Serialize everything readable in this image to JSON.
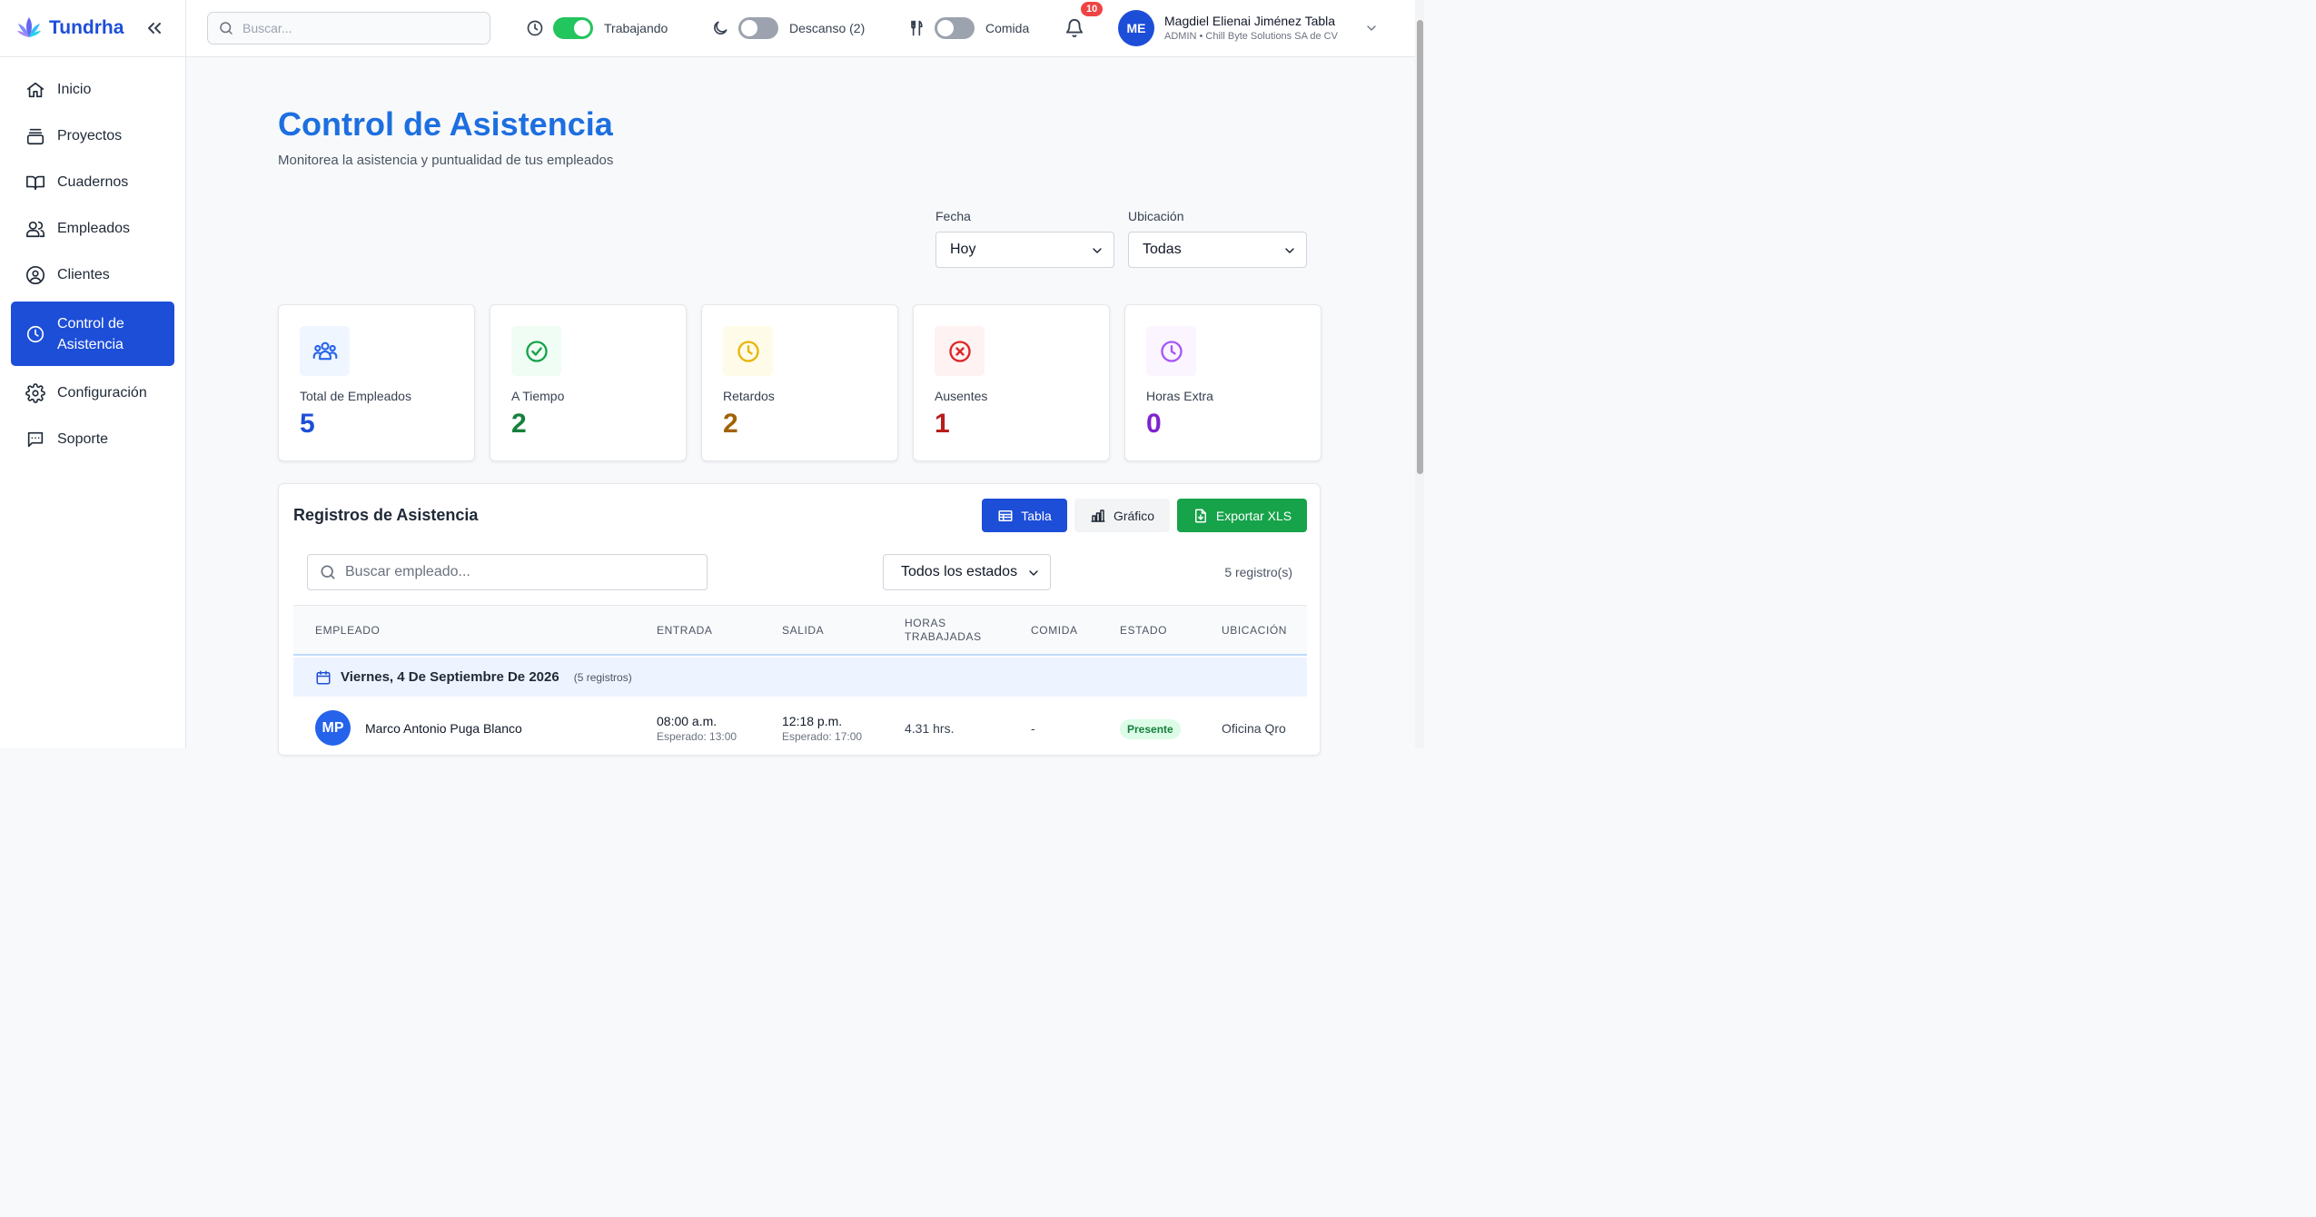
{
  "brand": {
    "name": "Tundrha"
  },
  "sidebar": {
    "items": [
      {
        "label": "Inicio",
        "icon": "home-icon"
      },
      {
        "label": "Proyectos",
        "icon": "folder-icon"
      },
      {
        "label": "Cuadernos",
        "icon": "book-icon"
      },
      {
        "label": "Empleados",
        "icon": "users-icon"
      },
      {
        "label": "Clientes",
        "icon": "user-circle-icon"
      },
      {
        "label": "Control de Asistencia",
        "icon": "clock-icon",
        "active": true
      },
      {
        "label": "Configuración",
        "icon": "gear-icon"
      },
      {
        "label": "Soporte",
        "icon": "chat-icon"
      }
    ]
  },
  "topbar": {
    "search_placeholder": "Buscar...",
    "status_working": {
      "label": "Trabajando",
      "on": true
    },
    "status_break": {
      "label": "Descanso (2)",
      "on": false
    },
    "status_lunch": {
      "label": "Comida",
      "on": false
    },
    "notifications_count": "10",
    "user": {
      "initials": "ME",
      "name": "Magdiel Elienai Jiménez Tabla",
      "role": "ADMIN • Chill Byte Solutions SA de CV"
    }
  },
  "page": {
    "title": "Control de Asistencia",
    "subtitle": "Monitorea la asistencia y puntualidad de tus empleados"
  },
  "filters": {
    "date_label": "Fecha",
    "date_value": "Hoy",
    "location_label": "Ubicación",
    "location_value": "Todas"
  },
  "stats": [
    {
      "label": "Total de Empleados",
      "value": "5",
      "color": "#1d4ed8",
      "bg": "#eff6ff",
      "icon": "users-icon"
    },
    {
      "label": "A Tiempo",
      "value": "2",
      "color": "#15803d",
      "bg": "#f0fdf4",
      "icon": "check-circle-icon"
    },
    {
      "label": "Retardos",
      "value": "2",
      "color": "#a16207",
      "bg": "#fefce8",
      "icon": "clock-icon"
    },
    {
      "label": "Ausentes",
      "value": "1",
      "color": "#b91c1c",
      "bg": "#fef2f2",
      "icon": "x-circle-icon"
    },
    {
      "label": "Horas Extra",
      "value": "0",
      "color": "#7e22ce",
      "bg": "#faf5ff",
      "icon": "clock-icon"
    }
  ],
  "records": {
    "title": "Registros de Asistencia",
    "view_table_label": "Tabla",
    "view_chart_label": "Gráfico",
    "export_label": "Exportar XLS",
    "search_placeholder": "Buscar empleado...",
    "status_filter": "Todos los estados",
    "count_text": "5 registro(s)",
    "columns": {
      "employee": "EMPLEADO",
      "entry": "ENTRADA",
      "exit": "SALIDA",
      "hours_1": "HORAS",
      "hours_2": "TRABAJADAS",
      "lunch": "COMIDA",
      "status": "ESTADO",
      "location": "UBICACIÓN"
    },
    "group": {
      "date": "Viernes, 4 De Septiembre De 2026",
      "count": "(5 registros)"
    },
    "rows": [
      {
        "initials": "MP",
        "name": "Marco Antonio Puga Blanco",
        "entry": "08:00 a.m.",
        "entry_expected": "Esperado: 13:00",
        "exit": "12:18 p.m.",
        "exit_expected": "Esperado: 17:00",
        "hours": "4.31 hrs.",
        "lunch": "-",
        "status": "Presente",
        "location": "Oficina Qro"
      }
    ]
  }
}
